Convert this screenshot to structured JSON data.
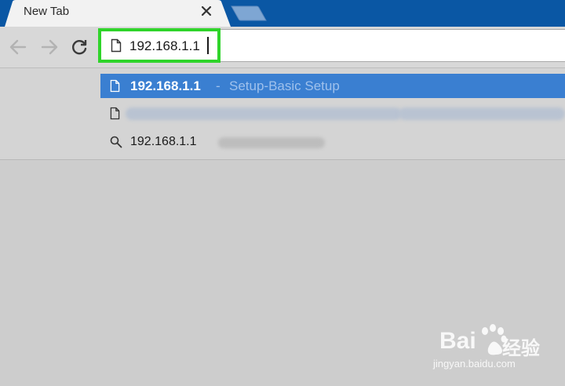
{
  "tab": {
    "title": "New Tab"
  },
  "omnibox": {
    "value": "192.168.1.1"
  },
  "suggestions": [
    {
      "url": "192.168.1.1",
      "separator": "-",
      "title": "Setup-Basic Setup",
      "type": "page"
    },
    {
      "url": "",
      "title": "",
      "type": "page"
    },
    {
      "query": "192.168.1.1",
      "type": "search"
    }
  ],
  "colors": {
    "tab_strip": "#0a57a4",
    "selected_row": "#3a7fd1",
    "highlight": "#2fd42a"
  },
  "watermark": {
    "brand": "Bai",
    "brand_cn": "经验",
    "site": "jingyan.baidu.com"
  }
}
